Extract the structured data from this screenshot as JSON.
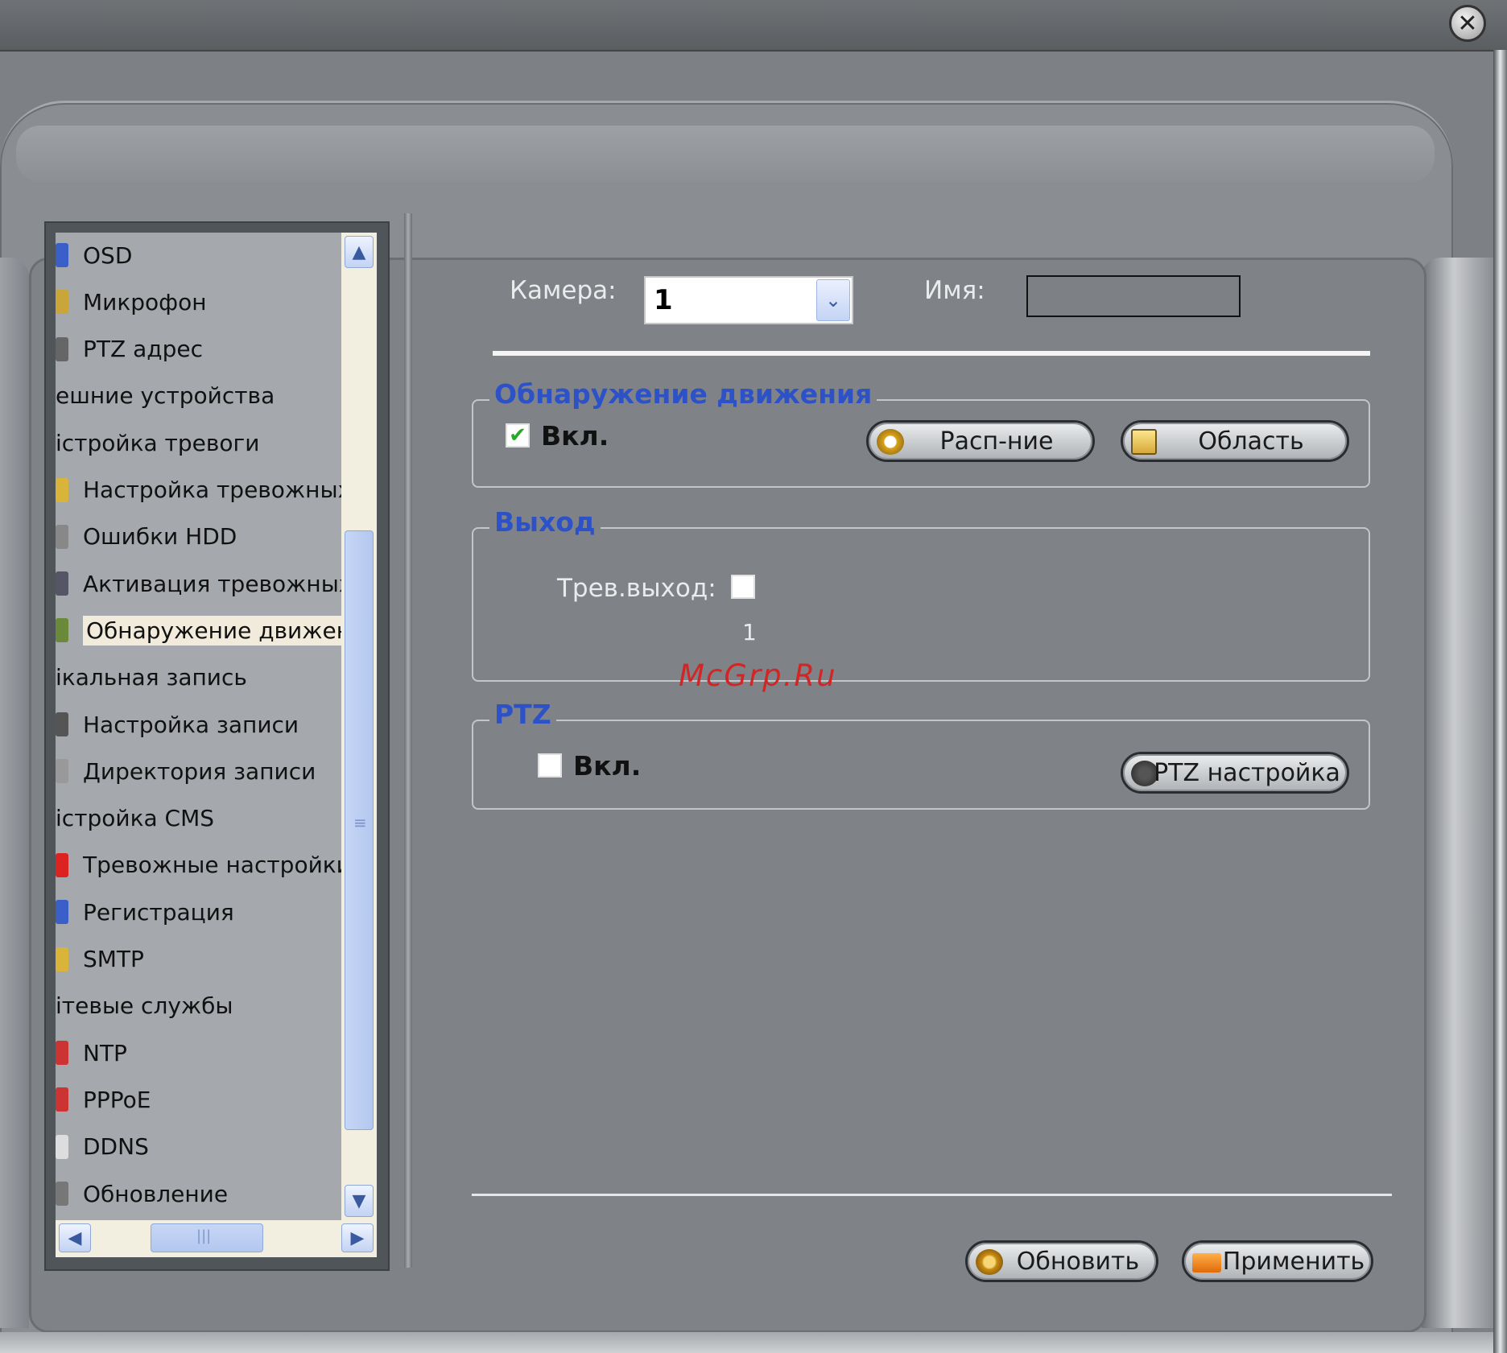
{
  "window": {
    "close_glyph": "✕"
  },
  "tree": {
    "items": [
      {
        "label": "OSD",
        "icon": "osd-icon",
        "indent": true,
        "selected": false
      },
      {
        "label": "Микрофон",
        "icon": "microphone-icon",
        "indent": true,
        "selected": false
      },
      {
        "label": "PTZ адрес",
        "icon": "ptz-icon",
        "indent": true,
        "selected": false
      },
      {
        "label": "ешние устройства",
        "icon": "",
        "indent": false,
        "selected": false
      },
      {
        "label": "іcтройка тревоги",
        "icon": "",
        "indent": false,
        "selected": false
      },
      {
        "label": "Настройка тревожных і",
        "icon": "alarm-icon",
        "indent": true,
        "selected": false
      },
      {
        "label": "Ошибки HDD",
        "icon": "hdd-icon",
        "indent": true,
        "selected": false
      },
      {
        "label": "Активация тревожных",
        "icon": "activation-icon",
        "indent": true,
        "selected": false
      },
      {
        "label": "Обнаружение движени:",
        "icon": "motion-icon",
        "indent": true,
        "selected": true
      },
      {
        "label": "ікальная запись",
        "icon": "",
        "indent": false,
        "selected": false
      },
      {
        "label": "Настройка записи",
        "icon": "record-icon",
        "indent": true,
        "selected": false
      },
      {
        "label": "Директория записи",
        "icon": "folder-icon",
        "indent": true,
        "selected": false
      },
      {
        "label": "іcтройка CMS",
        "icon": "",
        "indent": false,
        "selected": false
      },
      {
        "label": "Тревожные настройки",
        "icon": "alarm-bell-icon",
        "indent": true,
        "selected": false
      },
      {
        "label": "Регистрация",
        "icon": "registration-icon",
        "indent": true,
        "selected": false
      },
      {
        "label": "SMTP",
        "icon": "mail-icon",
        "indent": true,
        "selected": false
      },
      {
        "label": "ітевые службы",
        "icon": "",
        "indent": false,
        "selected": false
      },
      {
        "label": "NTP",
        "icon": "clock-icon",
        "indent": true,
        "selected": false
      },
      {
        "label": "PPPoE",
        "icon": "network-icon",
        "indent": true,
        "selected": false
      },
      {
        "label": "DDNS",
        "icon": "page-icon",
        "indent": true,
        "selected": false
      },
      {
        "label": "Обновление",
        "icon": "update-icon",
        "indent": true,
        "selected": false
      }
    ],
    "scroll_up": "▲",
    "scroll_down": "▼",
    "scroll_left": "◀",
    "scroll_right": "▶",
    "thumb_grip": "≡",
    "hthumb_grip": "|||"
  },
  "header": {
    "camera_label": "Камера:",
    "camera_value": "1",
    "dropdown_glyph": "⌄",
    "name_label": "Имя:",
    "name_value": ""
  },
  "motion": {
    "title": "Обнаружение движения",
    "enabled_label": "Вкл.",
    "enabled_checked": true,
    "check_glyph": "✔",
    "schedule_label": "Расп-ние",
    "area_label": "Область"
  },
  "output": {
    "title": "Выход",
    "alarm_out_label": "Трев.выход:",
    "alarm_out_channel": "1",
    "alarm_out_checked": false
  },
  "ptz": {
    "title": "PTZ",
    "enabled_label": "Вкл.",
    "enabled_checked": false,
    "settings_label": "PTZ настройка"
  },
  "footer": {
    "refresh_label": "Обновить",
    "apply_label": "Применить"
  },
  "watermark": "McGrp.Ru",
  "colors": {
    "group_title": "#2d52c8",
    "background": "#7f8387",
    "watermark": "#d22626",
    "selection": "#f2ebdb"
  }
}
